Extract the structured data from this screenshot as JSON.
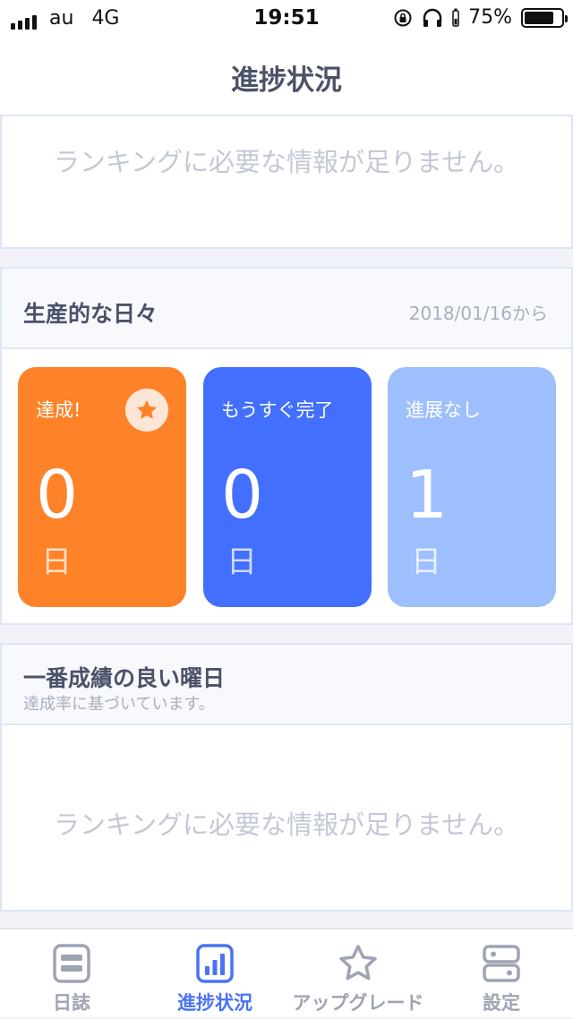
{
  "status_bar": {
    "carrier": "au",
    "network": "4G",
    "time": "19:51",
    "battery": "75%"
  },
  "nav": {
    "title": "進捗状況"
  },
  "ranking_empty": {
    "message": "ランキングに必要な情報が足りません。"
  },
  "productive_days": {
    "title": "生産的な日々",
    "since": "2018/01/16から",
    "tiles": [
      {
        "label": "達成!",
        "value": "0",
        "unit": "日",
        "color": "#fe8227",
        "icon": "star-icon"
      },
      {
        "label": "もうすぐ完了",
        "value": "0",
        "unit": "日",
        "color": "#426ffe"
      },
      {
        "label": "進展なし",
        "value": "1",
        "unit": "日",
        "color": "#9ebffd"
      }
    ]
  },
  "best_weekday": {
    "title": "一番成績の良い曜日",
    "subtitle": "達成率に基づいています。",
    "empty_message": "ランキングに必要な情報が足りません。"
  },
  "tab_bar": {
    "items": [
      {
        "label": "日誌",
        "icon": "journal-icon",
        "active": false
      },
      {
        "label": "進捗状況",
        "icon": "bar-chart-icon",
        "active": true
      },
      {
        "label": "アップグレード",
        "icon": "star-outline-icon",
        "active": false
      },
      {
        "label": "設定",
        "icon": "settings-icon",
        "active": false
      }
    ],
    "active_color": "#4a72f5",
    "inactive_color": "#9ea4b4"
  }
}
